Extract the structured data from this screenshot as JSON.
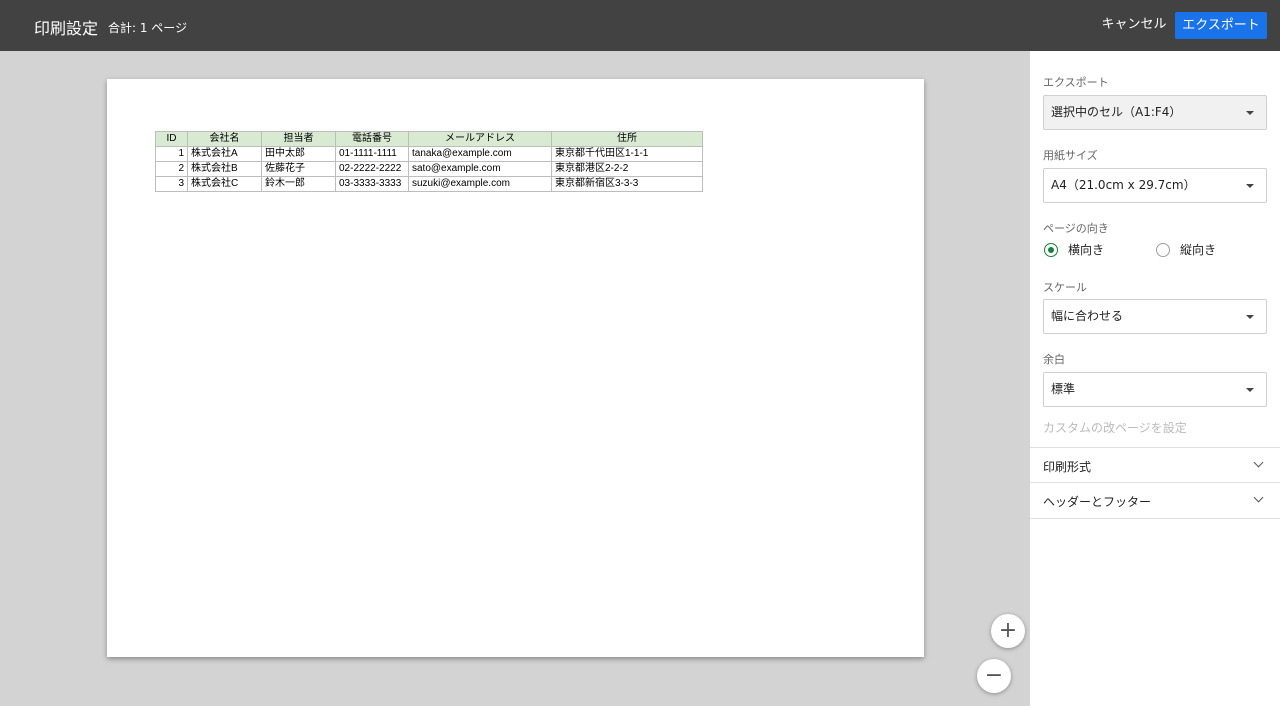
{
  "header": {
    "title": "印刷設定",
    "page_count": "合計: 1 ページ",
    "cancel_label": "キャンセル",
    "export_label": "エクスポート"
  },
  "sheet": {
    "columns": [
      "ID",
      "会社名",
      "担当者",
      "電話番号",
      "メールアドレス",
      "住所"
    ],
    "rows": [
      [
        "1",
        "株式会社A",
        "田中太郎",
        "01-1111-1111",
        "tanaka@example.com",
        "東京都千代田区1-1-1"
      ],
      [
        "2",
        "株式会社B",
        "佐藤花子",
        "02-2222-2222",
        "sato@example.com",
        "東京都港区2-2-2"
      ],
      [
        "3",
        "株式会社C",
        "鈴木一郎",
        "03-3333-3333",
        "suzuki@example.com",
        "東京都新宿区3-3-3"
      ]
    ],
    "header_color": "#d9ead3"
  },
  "zoom": {
    "in_label": "+",
    "out_label": "−"
  },
  "panel": {
    "export": {
      "label": "エクスポート",
      "value": "選択中のセル（A1:F4）"
    },
    "paper_size": {
      "label": "用紙サイズ",
      "value": "A4（21.0cm x 29.7cm）"
    },
    "orientation": {
      "label": "ページの向き",
      "landscape": "横向き",
      "portrait": "縦向き",
      "selected": "横向き"
    },
    "scale": {
      "label": "スケール",
      "value": "幅に合わせる"
    },
    "margins": {
      "label": "余白",
      "value": "標準"
    },
    "custom_breaks": "カスタムの改ページを設定",
    "print_format": "印刷形式",
    "header_footer": "ヘッダーとフッター"
  },
  "colors": {
    "topbar": "#424242",
    "accent": "#1a73e8",
    "radio_selected": "#188038"
  }
}
